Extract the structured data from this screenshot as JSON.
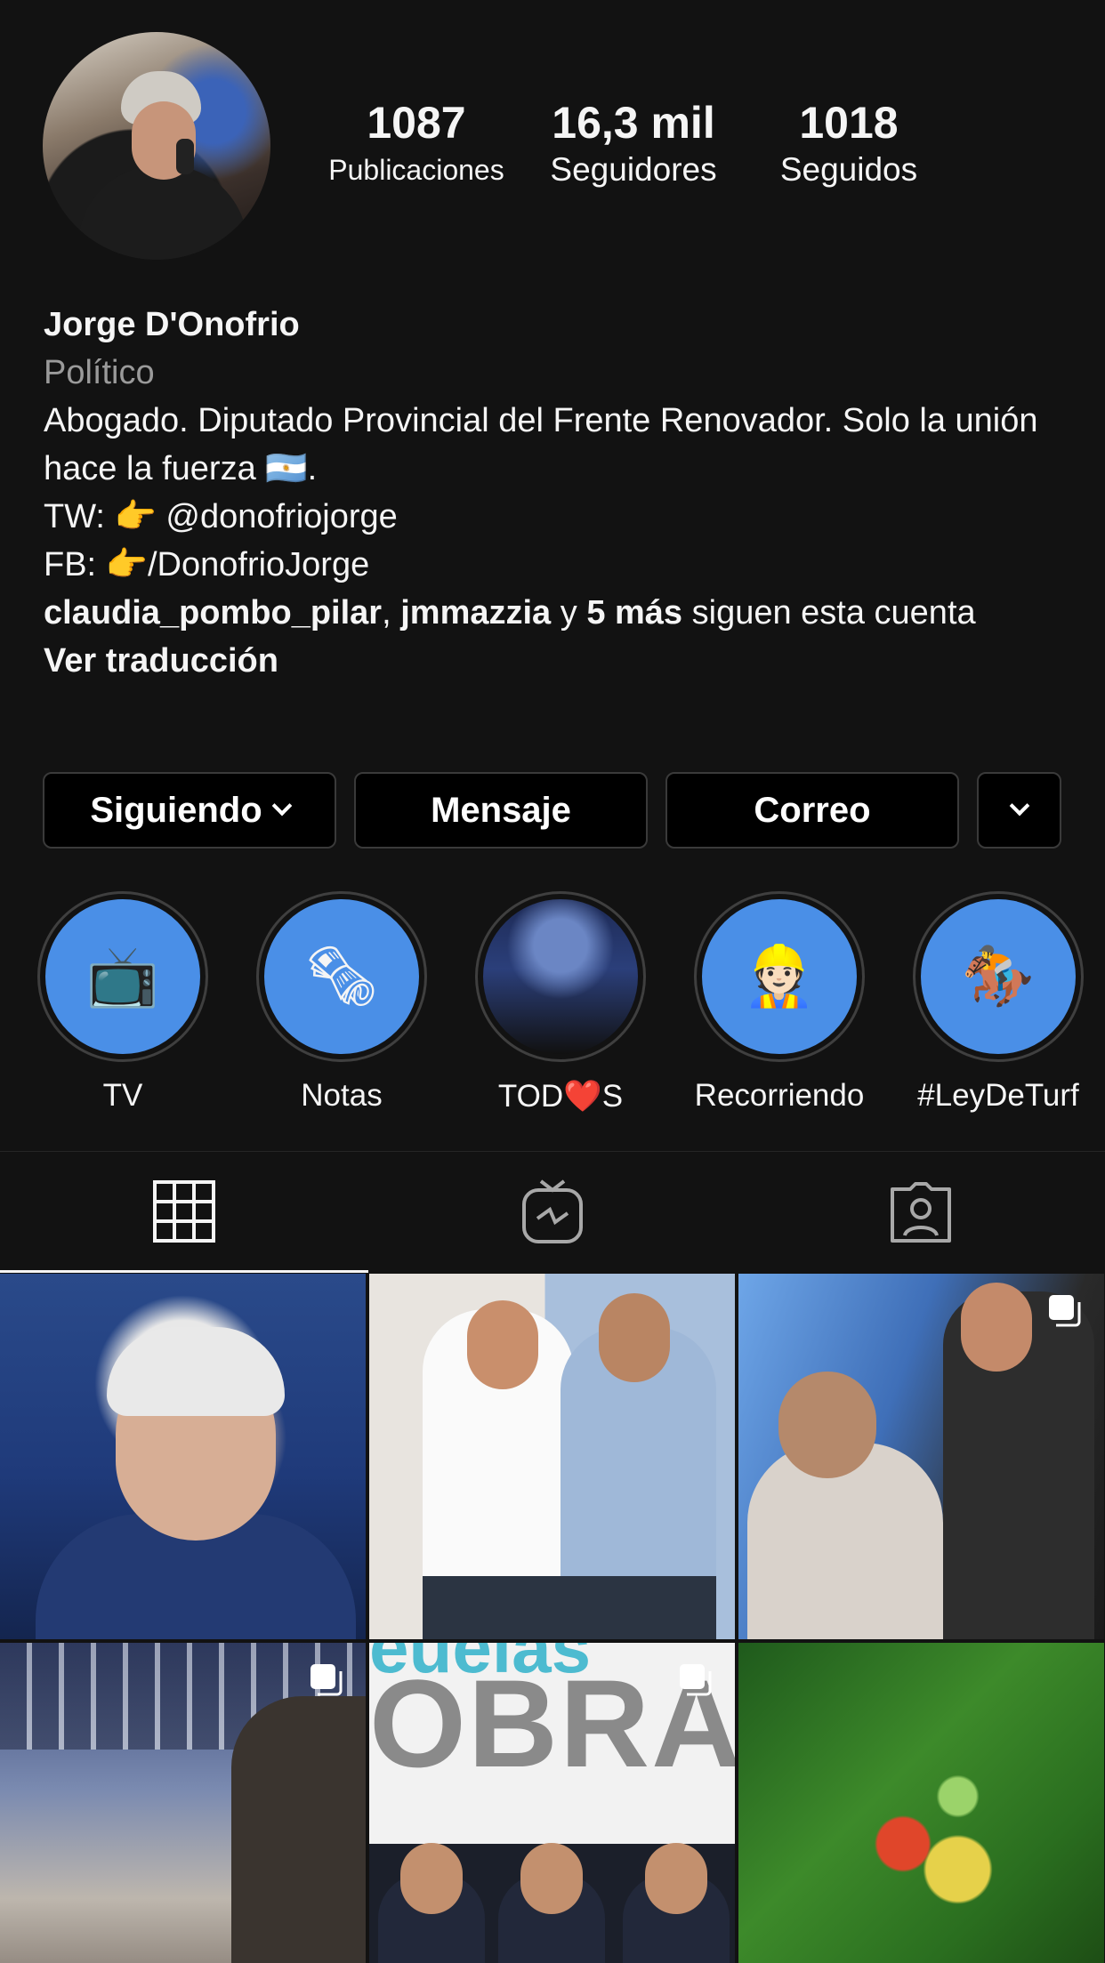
{
  "profile": {
    "name": "Jorge D'Onofrio",
    "category": "Político",
    "bio_line1": "Abogado. Diputado Provincial del Frente Renovador. Solo la unión hace la fuerza 🇦🇷.",
    "bio_tw": "TW: 👉 @donofriojorge",
    "bio_fb": "FB: 👉/DonofrioJorge",
    "followed_by_user1": "claudia_pombo_pilar",
    "followed_by_sep1": ", ",
    "followed_by_user2": "jmmazzia",
    "followed_by_sep2": " y ",
    "followed_by_more": "5 más",
    "followed_by_suffix": " siguen esta cuenta",
    "translate_label": "Ver traducción"
  },
  "stats": {
    "posts_count": "1087",
    "posts_label": "Publicaciones",
    "followers_count": "16,3 mil",
    "followers_label": "Seguidores",
    "following_count": "1018",
    "following_label": "Seguidos"
  },
  "actions": {
    "following_label": "Siguiendo",
    "message_label": "Mensaje",
    "email_label": "Correo"
  },
  "highlights": [
    {
      "label": "TV",
      "icon": "📺"
    },
    {
      "label": "Notas",
      "icon": "🗞"
    },
    {
      "label": "TOD❤️S",
      "icon": "photo"
    },
    {
      "label": "Recorriendo",
      "icon": "👷🏻"
    },
    {
      "label": "#LeyDeTurf",
      "icon": "🏇"
    }
  ],
  "tabs": [
    {
      "name": "grid-icon",
      "active": true
    },
    {
      "name": "igtv-icon",
      "active": false
    },
    {
      "name": "tagged-icon",
      "active": false
    }
  ],
  "posts": [
    {
      "multi": false
    },
    {
      "multi": false
    },
    {
      "multi": true
    },
    {
      "multi": true
    },
    {
      "multi": true,
      "overlay_top": "euelas",
      "overlay_main": "OBRA"
    },
    {
      "multi": false
    }
  ],
  "colors": {
    "background": "#121212",
    "highlight_fill": "#4a8fe7",
    "muted_text": "#9a9a9a"
  }
}
